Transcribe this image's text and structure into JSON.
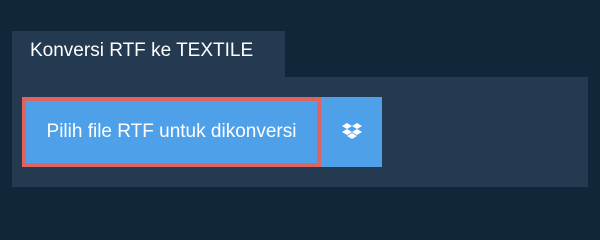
{
  "tab": {
    "label": "Konversi RTF ke TEXTILE"
  },
  "upload": {
    "button_label": "Pilih file RTF untuk dikonversi"
  },
  "dropbox": {
    "icon": "dropbox-icon"
  },
  "colors": {
    "page_background": "#12263a",
    "panel_background": "#233a51",
    "button_blue": "#4ea0e8",
    "focus_outline": "#dd6460"
  }
}
